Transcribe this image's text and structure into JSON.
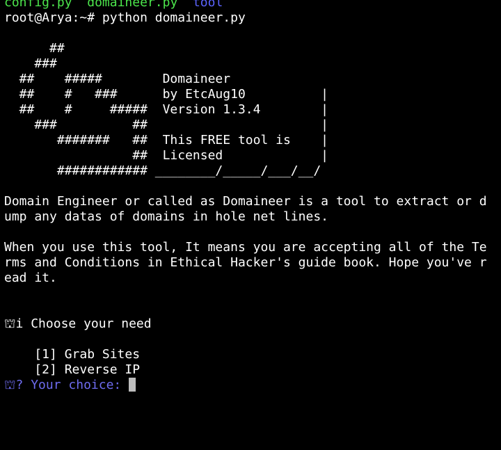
{
  "ls": {
    "file1": "config.py",
    "file2": "domaineer.py",
    "dir": "tool"
  },
  "shell": {
    "prompt": "root@Arya:~#",
    "command": "python domaineer.py"
  },
  "banner": [
    "      ##",
    "    ###",
    "  ##    #####        Domaineer",
    "  ##    #   ###      by EtcAug10          |",
    "  ##    #     #####  Version 1.3.4        |",
    "    ###          ##                       |",
    "       #######   ##  This FREE tool is    |",
    "                 ##  Licensed             |",
    "       ############ ________/_____/___/__/"
  ],
  "description": [
    "Domain Engineer or called as Domaineer is a tool to extract or d",
    "ump any datas of domains in hole net lines."
  ],
  "terms": [
    "When you use this tool, It means you are accepting all of the Te",
    "rms and Conditions in Ethical Hacker's guide book. Hope you've r",
    "ead it."
  ],
  "menu": {
    "heading": "⛫i Choose your need",
    "options": [
      "    [1] Grab Sites",
      "    [2] Reverse IP"
    ],
    "choice_prompt": "⛫? Your choice: "
  }
}
